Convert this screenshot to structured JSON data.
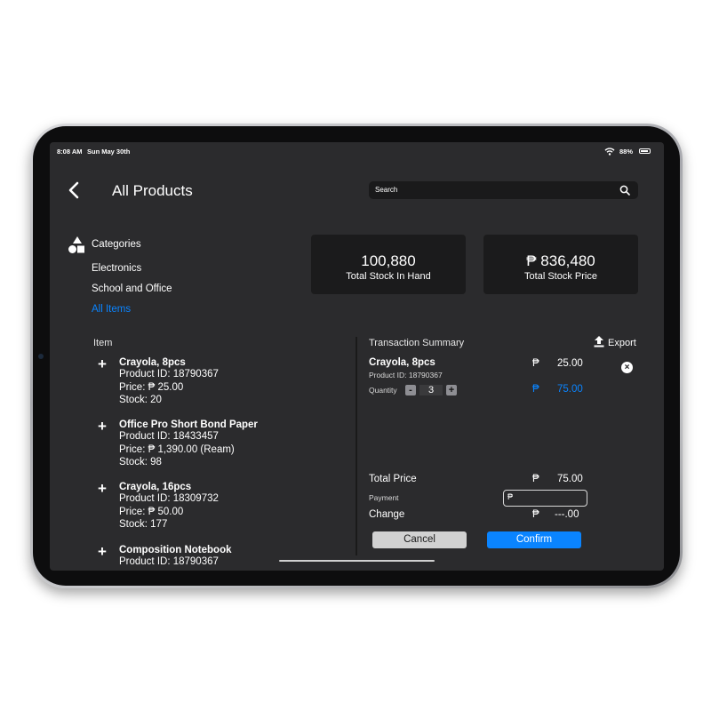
{
  "status_bar": {
    "time": "8:08 AM",
    "date": "Sun  May  30th",
    "battery": "88%"
  },
  "header": {
    "title": "All Products",
    "search_placeholder": "Search"
  },
  "categories": {
    "heading": "Categories",
    "items": [
      {
        "label": "Electronics"
      },
      {
        "label": "School and Office"
      },
      {
        "label": "All Items"
      }
    ],
    "active_color": "#0a84ff"
  },
  "stats": [
    {
      "value": "100,880",
      "label": "Total Stock In Hand"
    },
    {
      "value": "₱ 836,480",
      "label": "Total Stock Price"
    }
  ],
  "item_list": {
    "heading": "Item",
    "items": [
      {
        "name": "Crayola, 8pcs",
        "product_id": "Product ID: 18790367",
        "price": "Price: ₱ 25.00",
        "stock": "Stock: 20"
      },
      {
        "name": "Office Pro Short Bond Paper",
        "product_id": "Product ID: 18433457",
        "price": "Price: ₱ 1,390.00 (Ream)",
        "stock": "Stock: 98"
      },
      {
        "name": "Crayola, 16pcs",
        "product_id": "Product ID: 18309732",
        "price": "Price: ₱ 50.00",
        "stock": "Stock: 177"
      },
      {
        "name": "Composition Notebook",
        "product_id": "Product ID: 18790367",
        "price": "",
        "stock": ""
      }
    ]
  },
  "transaction": {
    "heading": "Transaction Summary",
    "export_label": "Export",
    "line_item": {
      "name": "Crayola, 8pcs",
      "product_id": "Product ID: 18790367",
      "currency": "₱",
      "unit_price": "25.00",
      "quantity_label": "Quantity",
      "quantity": "3",
      "minus": "-",
      "plus": "+",
      "line_total": "75.00",
      "total_color": "#0a84ff"
    },
    "total_price_label": "Total Price",
    "total_currency": "₱",
    "total_price": "75.00",
    "payment_label": "Payment",
    "payment_currency": "₱",
    "change_label": "Change",
    "change_currency": "₱",
    "change_value": "---.00",
    "cancel_label": "Cancel",
    "confirm_label": "Confirm",
    "confirm_color": "#0a84ff"
  }
}
